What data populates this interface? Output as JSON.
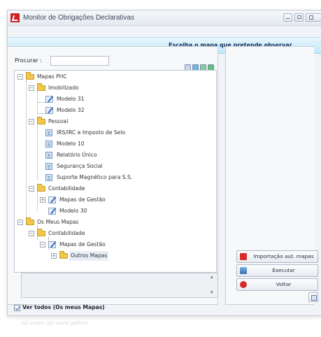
{
  "window": {
    "title": "Monitor de Obrigações Declarativas"
  },
  "banner": {
    "text": "Escolha o mapa que pretende observar"
  },
  "search": {
    "label": "Procurar :",
    "value": ""
  },
  "tree": {
    "nodes": [
      {
        "label": "Mapas PHC",
        "icon": "folder-icon",
        "expanded": true
      },
      {
        "label": "Imobilizado",
        "icon": "folder-icon",
        "expanded": true
      },
      {
        "label": "Modelo 31",
        "icon": "edit-doc-icon"
      },
      {
        "label": "Modelo 32",
        "icon": "edit-doc-icon"
      },
      {
        "label": "Pessoal",
        "icon": "folder-icon",
        "expanded": true
      },
      {
        "label": "IRS/IRC e Imposto de Selo",
        "icon": "doc-icon"
      },
      {
        "label": "Modelo 10",
        "icon": "doc-icon"
      },
      {
        "label": "Relatório Único",
        "icon": "doc-icon"
      },
      {
        "label": "Segurança Social",
        "icon": "doc-icon"
      },
      {
        "label": "Suporte Magnético para S.S.",
        "icon": "doc-icon"
      },
      {
        "label": "Contabilidade",
        "icon": "folder-icon",
        "expanded": true
      },
      {
        "label": "Mapas de Gestão",
        "icon": "edit-doc-icon",
        "expanded": false
      },
      {
        "label": "Modelo 30",
        "icon": "edit-doc-icon"
      },
      {
        "label": "Os Meus Mapas",
        "icon": "folder-icon",
        "expanded": true
      },
      {
        "label": "Contabilidade",
        "icon": "folder-icon",
        "expanded": true
      },
      {
        "label": "Mapas de Gestão",
        "icon": "edit-doc-icon",
        "expanded": true
      },
      {
        "label": "Outros Mapas",
        "icon": "folder-icon",
        "expanded": false
      }
    ]
  },
  "actions": {
    "import_label": "Importação aut. mapas",
    "run_label": "Executar",
    "back_label": "Voltar"
  },
  "show_all": {
    "label": "Ver todos (Os meus Mapas)",
    "checked": true
  },
  "colors": {
    "banner": "#c3e8f9",
    "brand": "#d11f2a"
  }
}
